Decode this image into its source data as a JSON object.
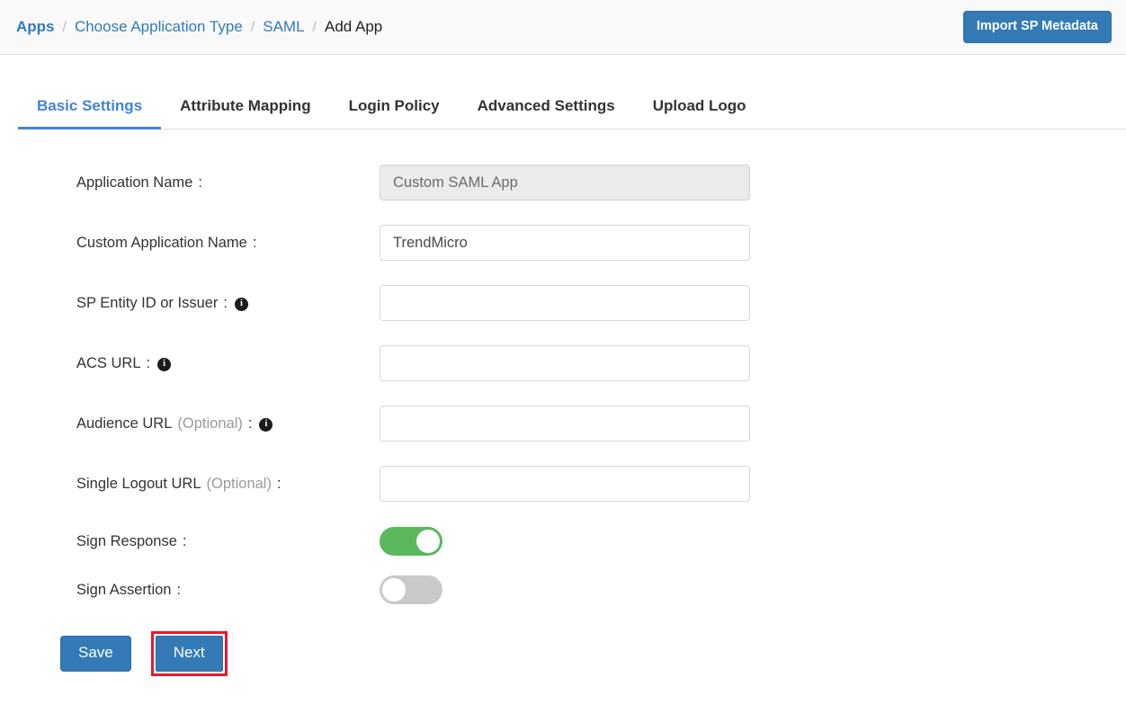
{
  "breadcrumb": {
    "items": [
      {
        "label": "Apps",
        "type": "link-bold"
      },
      {
        "label": "Choose Application Type",
        "type": "link"
      },
      {
        "label": "SAML",
        "type": "link"
      },
      {
        "label": "Add App",
        "type": "current"
      }
    ],
    "separator": "/"
  },
  "topbar": {
    "import_button_label": "Import SP Metadata"
  },
  "tabs": [
    {
      "label": "Basic Settings",
      "active": true
    },
    {
      "label": "Attribute Mapping",
      "active": false
    },
    {
      "label": "Login Policy",
      "active": false
    },
    {
      "label": "Advanced Settings",
      "active": false
    },
    {
      "label": "Upload Logo",
      "active": false
    }
  ],
  "form": {
    "fields": [
      {
        "label": "Application Name",
        "optional": "",
        "colon": ":",
        "info": false,
        "value": "Custom SAML App",
        "placeholder": "",
        "disabled": true
      },
      {
        "label": "Custom Application Name",
        "optional": "",
        "colon": ":",
        "info": true,
        "value": "TrendMicro",
        "placeholder": "",
        "disabled": false
      },
      {
        "label": "SP Entity ID or Issuer",
        "optional": "",
        "colon": ":",
        "info": true,
        "value": "",
        "placeholder": "",
        "disabled": false
      },
      {
        "label": "ACS URL",
        "optional": "",
        "colon": ":",
        "info": true,
        "value": "",
        "placeholder": "",
        "disabled": false
      },
      {
        "label": "Audience URL",
        "optional": "(Optional)",
        "colon": ":",
        "info": true,
        "value": "",
        "placeholder": "",
        "disabled": false
      },
      {
        "label": "Single Logout URL",
        "optional": "(Optional)",
        "colon": ":",
        "info": false,
        "value": "",
        "placeholder": "",
        "disabled": false
      }
    ],
    "toggles": [
      {
        "label": "Sign Response",
        "colon": ":",
        "on": true
      },
      {
        "label": "Sign Assertion",
        "colon": ":",
        "on": false
      }
    ],
    "save_label": "Save",
    "next_label": "Next"
  },
  "icons": {
    "info": "i"
  },
  "colors": {
    "primary_blue": "#337ab7",
    "tab_active_blue": "#4285d6",
    "link_blue": "#337ab7",
    "toggle_on_green": "#5cb85c",
    "toggle_off_grey": "#c9c9c9",
    "highlight_red": "#e8192c",
    "disabled_field_bg": "#ebebeb"
  }
}
